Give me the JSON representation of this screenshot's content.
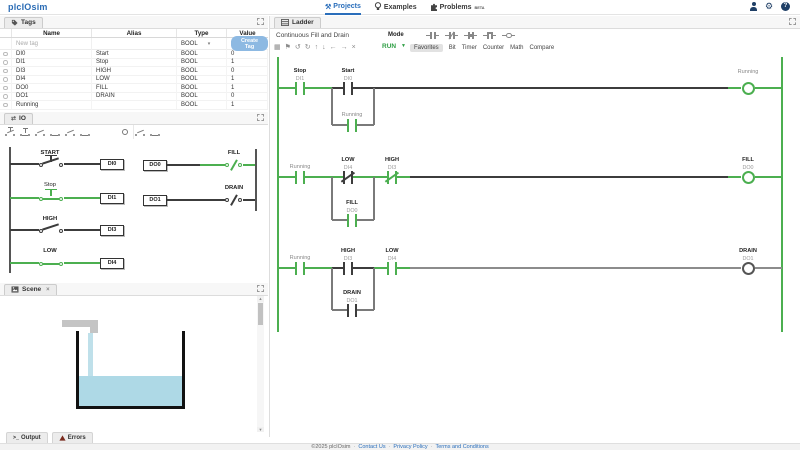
{
  "topbar": {
    "logo": "plcIOsim",
    "nav": [
      {
        "label": "Projects",
        "icon": "tools-icon",
        "active": true
      },
      {
        "label": "Examples",
        "icon": "lightbulb-icon",
        "active": false
      },
      {
        "label": "Problems",
        "icon": "puzzle-icon",
        "active": false,
        "badge": "BETA"
      }
    ],
    "right_icons": [
      "user-icon",
      "gear-icon",
      "help-icon"
    ]
  },
  "tags_panel": {
    "title": "Tags",
    "columns": [
      "Name",
      "Alias",
      "Type",
      "Value"
    ],
    "new_tag_row": {
      "name_placeholder": "New tag",
      "type": "BOOL",
      "create_button": "Create Tag"
    },
    "rows": [
      {
        "name": "DI0",
        "alias": "Start",
        "type": "BOOL",
        "value": "0"
      },
      {
        "name": "DI1",
        "alias": "Stop",
        "type": "BOOL",
        "value": "1"
      },
      {
        "name": "DI3",
        "alias": "HIGH",
        "type": "BOOL",
        "value": "0"
      },
      {
        "name": "DI4",
        "alias": "LOW",
        "type": "BOOL",
        "value": "1"
      },
      {
        "name": "DO0",
        "alias": "FILL",
        "type": "BOOL",
        "value": "1"
      },
      {
        "name": "DO1",
        "alias": "DRAIN",
        "type": "BOOL",
        "value": "0"
      },
      {
        "name": "Running",
        "alias": "",
        "type": "BOOL",
        "value": "1"
      }
    ]
  },
  "io_panel": {
    "title": "IO",
    "toolbar_left_icons": [
      "pushbutton-no-icon",
      "pushbutton-nc-icon",
      "switch-open-icon",
      "switch-closed-icon",
      "sensor-open-icon",
      "sensor-closed-icon"
    ],
    "toolbar_right_icons": [
      "lamp-icon",
      "lamp-filled-icon",
      "valve-icon"
    ],
    "inputs": [
      {
        "label": "START",
        "address": "DI0",
        "kind": "push",
        "on": false
      },
      {
        "label": "Stop",
        "address": "DI1",
        "kind": "push",
        "on": true
      },
      {
        "label": "HIGH",
        "address": "DI3",
        "kind": "toggle",
        "on": false
      },
      {
        "label": "LOW",
        "address": "DI4",
        "kind": "toggle",
        "on": true
      }
    ],
    "outputs": [
      {
        "label": "FILL",
        "address": "DO0",
        "on": true
      },
      {
        "label": "DRAIN",
        "address": "DO1",
        "on": false
      }
    ]
  },
  "scene_panel": {
    "title": "Scene"
  },
  "ladder_panel": {
    "title": "Ladder",
    "program_name": "Continuous Fill and Drain",
    "mode_label": "Mode",
    "mode_value": "RUN",
    "toolbar_icons": [
      "select-icon",
      "flag-icon",
      "undo-icon",
      "redo-icon",
      "move-up-icon",
      "move-down-icon",
      "move-left-icon",
      "move-right-icon",
      "delete-icon"
    ],
    "palette_icons": [
      "no-contact-icon",
      "nc-contact-icon",
      "rising-edge-contact-icon",
      "falling-edge-contact-icon",
      "coil-icon"
    ],
    "instruction_tabs": [
      {
        "label": "Favorites",
        "active": true
      },
      {
        "label": "Bit",
        "active": false
      },
      {
        "label": "Timer",
        "active": false
      },
      {
        "label": "Counter",
        "active": false
      },
      {
        "label": "Math",
        "active": false
      },
      {
        "label": "Compare",
        "active": false
      }
    ],
    "rungs": [
      {
        "contacts": [
          {
            "label": "Stop",
            "addr": "DI1",
            "nc": false,
            "on": true
          },
          {
            "label": "Start",
            "addr": "DI0",
            "nc": false,
            "on": false,
            "branch": {
              "label": "Running",
              "addr": "",
              "nc": false,
              "on": true
            }
          }
        ],
        "coil": {
          "label": "Running",
          "addr": "",
          "on": true
        }
      },
      {
        "contacts": [
          {
            "label": "Running",
            "addr": "",
            "nc": false,
            "on": true
          },
          {
            "label": "LOW",
            "addr": "DI4",
            "nc": true,
            "on": false,
            "branch": {
              "label": "FILL",
              "addr": "DO0",
              "nc": false,
              "on": true
            }
          },
          {
            "label": "HIGH",
            "addr": "DI3",
            "nc": true,
            "on": true
          }
        ],
        "coil": {
          "label": "FILL",
          "addr": "DO0",
          "on": true
        }
      },
      {
        "contacts": [
          {
            "label": "Running",
            "addr": "",
            "nc": false,
            "on": true
          },
          {
            "label": "HIGH",
            "addr": "DI3",
            "nc": false,
            "on": false,
            "branch": {
              "label": "DRAIN",
              "addr": "DO1",
              "nc": false,
              "on": false
            }
          },
          {
            "label": "LOW",
            "addr": "DI4",
            "nc": false,
            "on": true
          }
        ],
        "coil": {
          "label": "DRAIN",
          "addr": "DO1",
          "on": false
        }
      }
    ]
  },
  "bottom_bar": {
    "output_tab": "Output",
    "errors_tab": "Errors"
  },
  "footer": {
    "copyright": "©2025 plcIOsim",
    "separator": "·",
    "links": [
      "Contact Us",
      "Privacy Policy",
      "Terms and Conditions"
    ]
  },
  "colors": {
    "energized": "#4caf50",
    "inactive_wire": "#3c3c3c",
    "gray_wire": "#8c8c8c",
    "branch_wire": "#7a7a7a",
    "accent_blue": "#2a6ebb",
    "run_green": "#2e9e44",
    "water": "#aed9e6",
    "pipe": "#c4c4c4"
  }
}
